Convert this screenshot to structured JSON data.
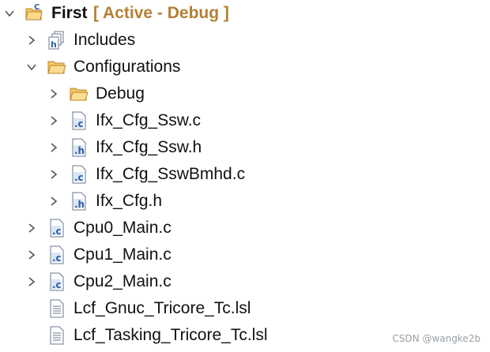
{
  "project": {
    "name": "First",
    "config_suffix": "[ Active - Debug ]"
  },
  "items": [
    {
      "label": "Includes",
      "type": "includes"
    },
    {
      "label": "Configurations",
      "type": "folder-open"
    },
    {
      "label": "Debug",
      "type": "folder"
    },
    {
      "label": "Ifx_Cfg_Ssw.c",
      "type": "c-file"
    },
    {
      "label": "Ifx_Cfg_Ssw.h",
      "type": "h-file"
    },
    {
      "label": "Ifx_Cfg_SswBmhd.c",
      "type": "c-file"
    },
    {
      "label": "Ifx_Cfg.h",
      "type": "h-file"
    },
    {
      "label": "Cpu0_Main.c",
      "type": "c-file"
    },
    {
      "label": "Cpu1_Main.c",
      "type": "c-file"
    },
    {
      "label": "Cpu2_Main.c",
      "type": "c-file"
    },
    {
      "label": "Lcf_Gnuc_Tricore_Tc.lsl",
      "type": "text-file"
    },
    {
      "label": "Lcf_Tasking_Tricore_Tc.lsl",
      "type": "text-file"
    }
  ],
  "watermark": "CSDN @wangke2b",
  "colors": {
    "accent": "#b47f35",
    "folder": "#e8b04a",
    "c_badge": "#3a6fb5",
    "h_badge": "#3a6fb5"
  }
}
